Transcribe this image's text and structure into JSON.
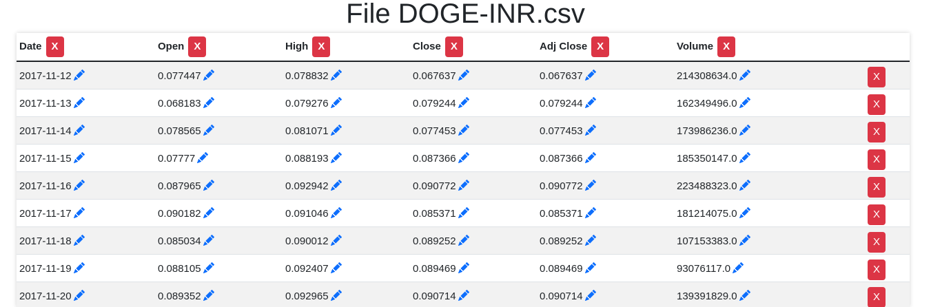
{
  "page_title": "File DOGE-INR.csv",
  "accent_color": "#0d6efd",
  "delete_color": "#dc3545",
  "delete_label": "X",
  "columns": [
    "Date",
    "Open",
    "High",
    "Close",
    "Adj Close",
    "Volume"
  ],
  "rows": [
    [
      "2017-11-12",
      "0.077447",
      "0.078832",
      "0.067637",
      "0.067637",
      "214308634.0"
    ],
    [
      "2017-11-13",
      "0.068183",
      "0.079276",
      "0.079244",
      "0.079244",
      "162349496.0"
    ],
    [
      "2017-11-14",
      "0.078565",
      "0.081071",
      "0.077453",
      "0.077453",
      "173986236.0"
    ],
    [
      "2017-11-15",
      "0.07777",
      "0.088193",
      "0.087366",
      "0.087366",
      "185350147.0"
    ],
    [
      "2017-11-16",
      "0.087965",
      "0.092942",
      "0.090772",
      "0.090772",
      "223488323.0"
    ],
    [
      "2017-11-17",
      "0.090182",
      "0.091046",
      "0.085371",
      "0.085371",
      "181214075.0"
    ],
    [
      "2017-11-18",
      "0.085034",
      "0.090012",
      "0.089252",
      "0.089252",
      "107153383.0"
    ],
    [
      "2017-11-19",
      "0.088105",
      "0.092407",
      "0.089469",
      "0.089469",
      "93076117.0"
    ],
    [
      "2017-11-20",
      "0.089352",
      "0.092965",
      "0.090714",
      "0.090714",
      "139391829.0"
    ]
  ],
  "icons": {
    "edit": "pencil-icon",
    "delete": "x-button"
  }
}
